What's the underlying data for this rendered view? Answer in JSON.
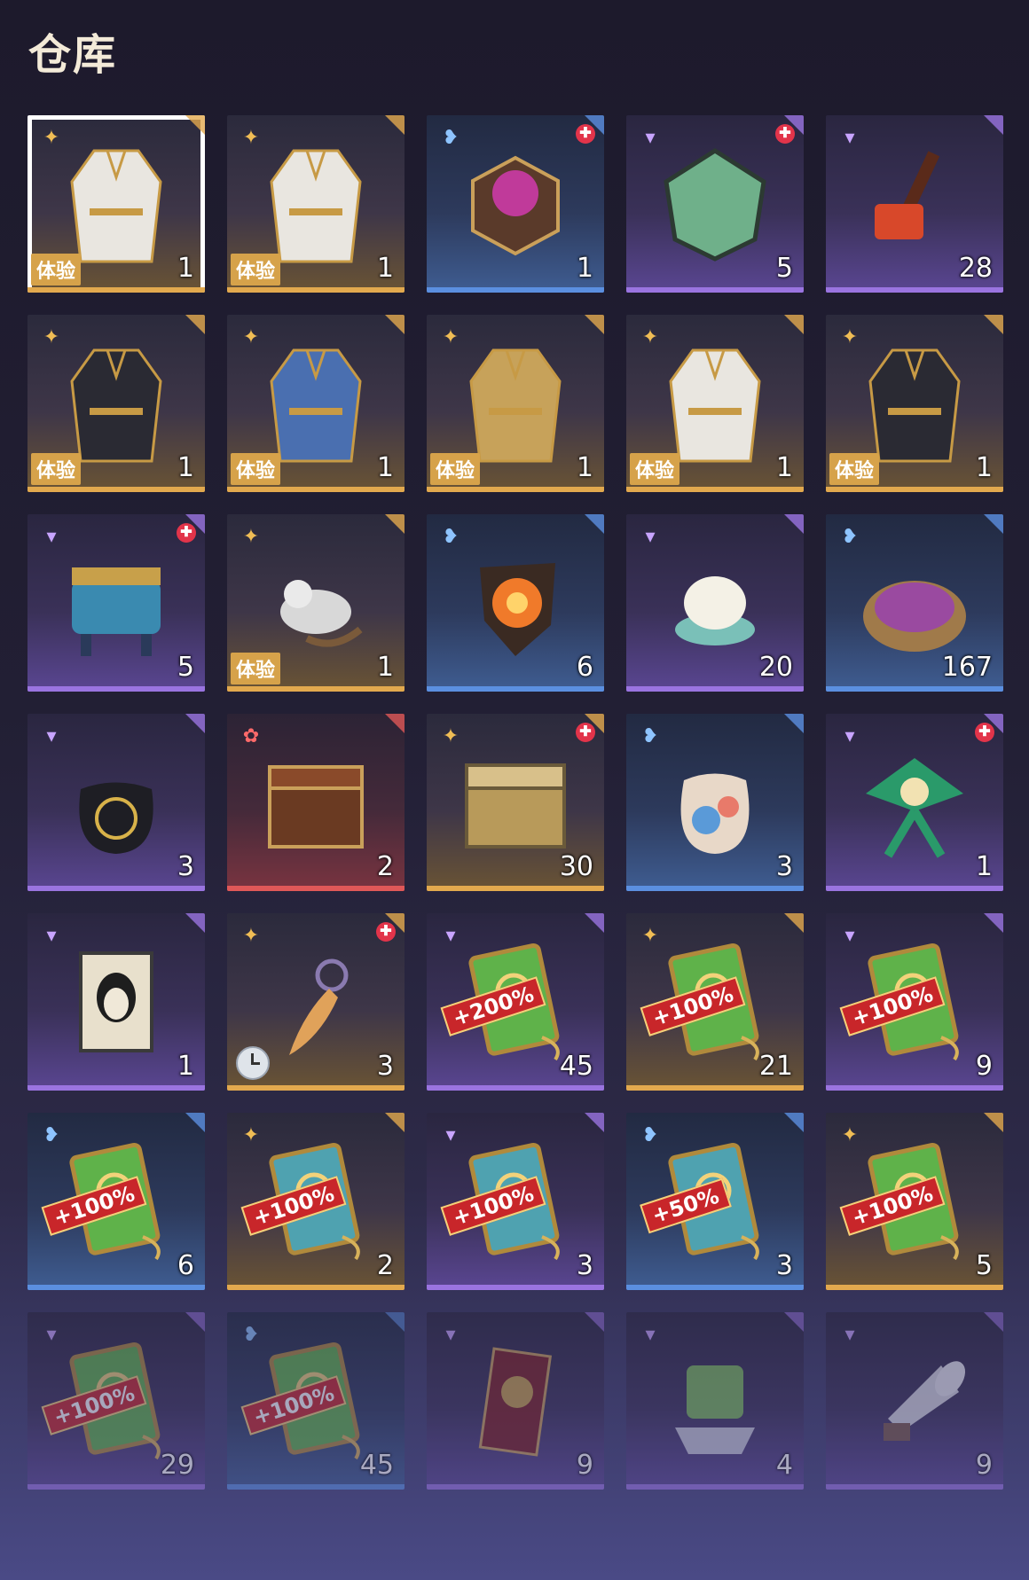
{
  "title": "仓库",
  "colors": {
    "gold": "#e2a94e",
    "blue": "#5b8fe0",
    "purple": "#9a74e0",
    "red": "#e05858"
  },
  "items": [
    {
      "rarity": "gold",
      "icon": "white-robe-outfit-icon",
      "qty": "1",
      "trial": "体验",
      "new": false
    },
    {
      "rarity": "gold",
      "icon": "blue-white-dress-outfit-icon",
      "qty": "1",
      "trial": "体验",
      "new": false
    },
    {
      "rarity": "blue",
      "icon": "hexagon-flower-box-icon",
      "qty": "1",
      "trial": "",
      "new": true
    },
    {
      "rarity": "purple",
      "icon": "jade-polyhedron-icon",
      "qty": "5",
      "trial": "",
      "new": true
    },
    {
      "rarity": "purple",
      "icon": "fire-hammer-icon",
      "qty": "28",
      "trial": "",
      "new": false
    },
    {
      "rarity": "gold",
      "icon": "black-gold-outfit-icon",
      "qty": "1",
      "trial": "体验",
      "new": false
    },
    {
      "rarity": "gold",
      "icon": "dark-blue-dress-outfit-icon",
      "qty": "1",
      "trial": "体验",
      "new": false
    },
    {
      "rarity": "gold",
      "icon": "gold-robe-outfit-icon",
      "qty": "1",
      "trial": "体验",
      "new": false
    },
    {
      "rarity": "gold",
      "icon": "white-lace-dress-outfit-icon",
      "qty": "1",
      "trial": "体验",
      "new": false
    },
    {
      "rarity": "gold",
      "icon": "black-armor-outfit-icon",
      "qty": "1",
      "trial": "体验",
      "new": false
    },
    {
      "rarity": "purple",
      "icon": "bronze-cauldron-icon",
      "qty": "5",
      "trial": "",
      "new": true
    },
    {
      "rarity": "gold",
      "icon": "flying-squirrel-pet-icon",
      "qty": "1",
      "trial": "体验",
      "new": false
    },
    {
      "rarity": "blue",
      "icon": "flame-stone-icon",
      "qty": "6",
      "trial": "",
      "new": false
    },
    {
      "rarity": "purple",
      "icon": "lotus-bowl-icon",
      "qty": "20",
      "trial": "",
      "new": false
    },
    {
      "rarity": "blue",
      "icon": "pigment-bowl-icon",
      "qty": "167",
      "trial": "",
      "new": false
    },
    {
      "rarity": "purple",
      "icon": "black-pouch-icon",
      "qty": "3",
      "trial": "",
      "new": false
    },
    {
      "rarity": "red",
      "icon": "wooden-chest-icon",
      "qty": "2",
      "trial": "",
      "new": false
    },
    {
      "rarity": "gold",
      "icon": "golden-chest-icon",
      "qty": "30",
      "trial": "",
      "new": true
    },
    {
      "rarity": "blue",
      "icon": "floral-pouch-icon",
      "qty": "3",
      "trial": "",
      "new": false
    },
    {
      "rarity": "purple",
      "icon": "jade-kite-icon",
      "qty": "1",
      "trial": "",
      "new": true
    },
    {
      "rarity": "purple",
      "icon": "portrait-scroll-icon",
      "qty": "1",
      "trial": "",
      "new": false
    },
    {
      "rarity": "gold",
      "icon": "amber-pendant-icon",
      "qty": "3",
      "trial": "",
      "new": true,
      "timed": true
    },
    {
      "rarity": "purple",
      "icon": "green-boost-tag-icon",
      "qty": "45",
      "trial": "",
      "new": false,
      "pct": "+200%"
    },
    {
      "rarity": "gold",
      "icon": "green-boost-tag-icon",
      "qty": "21",
      "trial": "",
      "new": false,
      "pct": "+100%"
    },
    {
      "rarity": "purple",
      "icon": "green-boost-tag-icon",
      "qty": "9",
      "trial": "",
      "new": false,
      "pct": "+100%"
    },
    {
      "rarity": "blue",
      "icon": "green-boost-tag-icon",
      "qty": "6",
      "trial": "",
      "new": false,
      "pct": "+100%"
    },
    {
      "rarity": "gold",
      "icon": "blue-boost-tag-icon",
      "qty": "2",
      "trial": "",
      "new": false,
      "pct": "+100%"
    },
    {
      "rarity": "purple",
      "icon": "blue-boost-tag-icon",
      "qty": "3",
      "trial": "",
      "new": false,
      "pct": "+100%"
    },
    {
      "rarity": "blue",
      "icon": "blue-boost-tag-icon",
      "qty": "3",
      "trial": "",
      "new": false,
      "pct": "+50%"
    },
    {
      "rarity": "gold",
      "icon": "green-boost-tag-icon",
      "qty": "5",
      "trial": "",
      "new": false,
      "pct": "+100%"
    },
    {
      "rarity": "purple",
      "icon": "green-boost-tag-icon",
      "qty": "29",
      "trial": "",
      "new": false,
      "pct": "+100%",
      "fade": true
    },
    {
      "rarity": "blue",
      "icon": "green-boost-tag-icon",
      "qty": "45",
      "trial": "",
      "new": false,
      "pct": "+100%",
      "fade": true
    },
    {
      "rarity": "purple",
      "icon": "red-talisman-card-icon",
      "qty": "9",
      "trial": "",
      "new": false,
      "fade": true
    },
    {
      "rarity": "purple",
      "icon": "jade-seal-icon",
      "qty": "4",
      "trial": "",
      "new": false,
      "fade": true
    },
    {
      "rarity": "purple",
      "icon": "silver-horn-icon",
      "qty": "9",
      "trial": "",
      "new": false,
      "fade": true
    }
  ]
}
